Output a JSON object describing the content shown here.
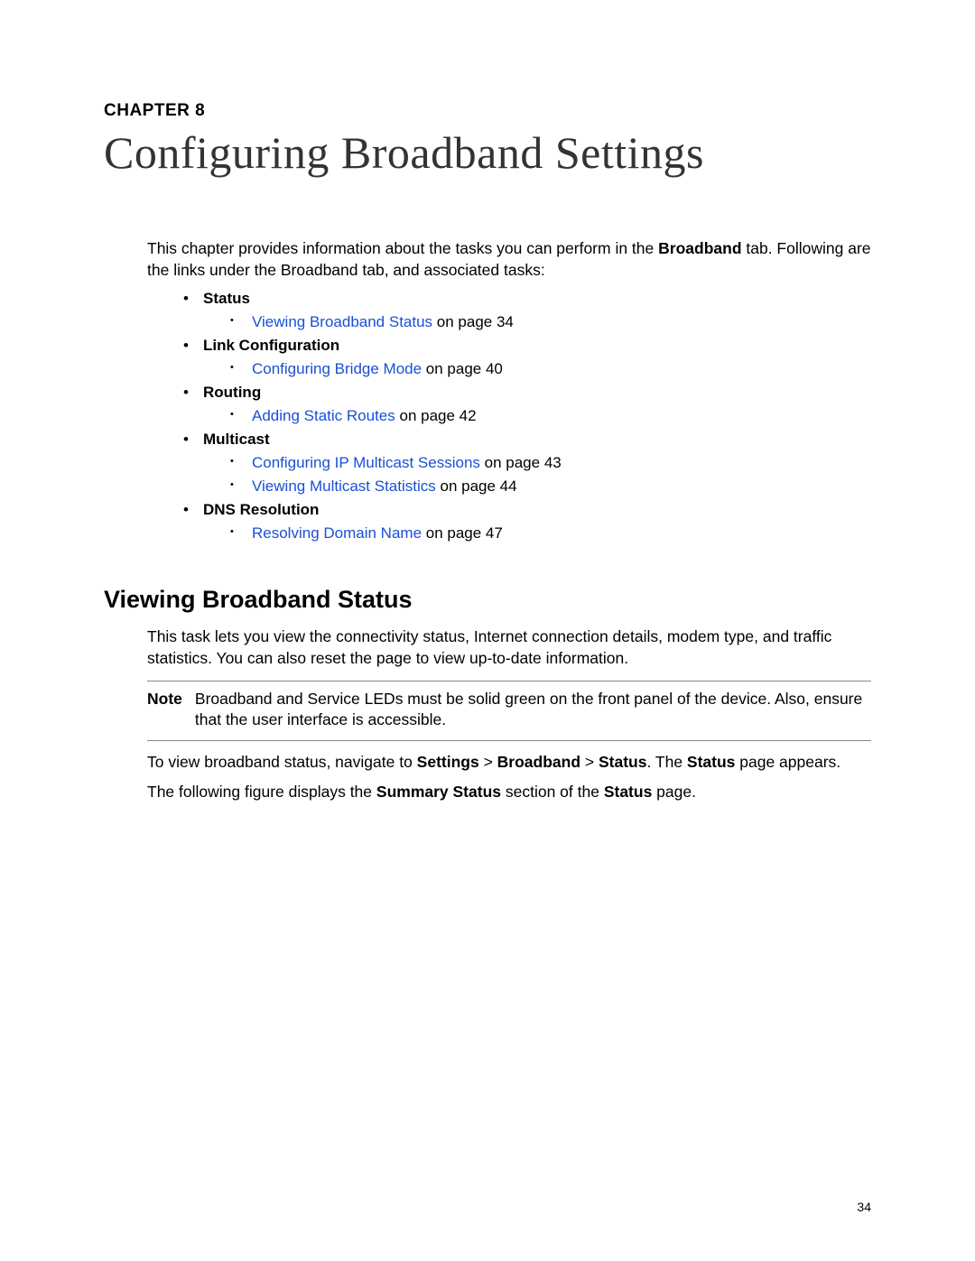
{
  "chapter": {
    "label": "CHAPTER 8",
    "title": "Configuring Broadband Settings"
  },
  "intro": {
    "prefix": "This chapter provides information about the tasks you can perform in the ",
    "bold_tab": "Broadband",
    "suffix": " tab. Following are the links under the Broadband tab, and associated tasks:"
  },
  "topics": [
    {
      "category": "Status",
      "items": [
        {
          "link": "Viewing Broadband Status",
          "page_text": " on page 34"
        }
      ]
    },
    {
      "category": "Link Configuration",
      "items": [
        {
          "link": "Configuring Bridge Mode",
          "page_text": " on page 40"
        }
      ]
    },
    {
      "category": "Routing",
      "items": [
        {
          "link": "Adding Static Routes",
          "page_text": " on page 42"
        }
      ]
    },
    {
      "category": "Multicast",
      "items": [
        {
          "link": "Configuring IP Multicast Sessions",
          "page_text": " on page 43"
        },
        {
          "link": "Viewing Multicast Statistics",
          "page_text": " on page 44"
        }
      ]
    },
    {
      "category": "DNS Resolution",
      "items": [
        {
          "link": "Resolving Domain Name",
          "page_text": " on page 47"
        }
      ]
    }
  ],
  "section": {
    "heading": "Viewing Broadband Status",
    "p1": "This task lets you view the connectivity status, Internet connection details, modem type, and traffic statistics. You can also reset the page to view up-to-date information.",
    "note_label": "Note",
    "note_text": "Broadband and Service LEDs must be solid green on the front panel of the device. Also, ensure that the user interface is accessible.",
    "nav": {
      "prefix": "To view broadband status, navigate to ",
      "p1": "Settings",
      "sep": " > ",
      "p2": "Broadband",
      "p3": "Status",
      "after_path": ". The ",
      "p4": "Status",
      "suffix": " page appears."
    },
    "fig": {
      "prefix": "The following figure displays the ",
      "b1": "Summary Status",
      "mid": " section of the ",
      "b2": "Status",
      "suffix": " page."
    }
  },
  "page_number": "34"
}
